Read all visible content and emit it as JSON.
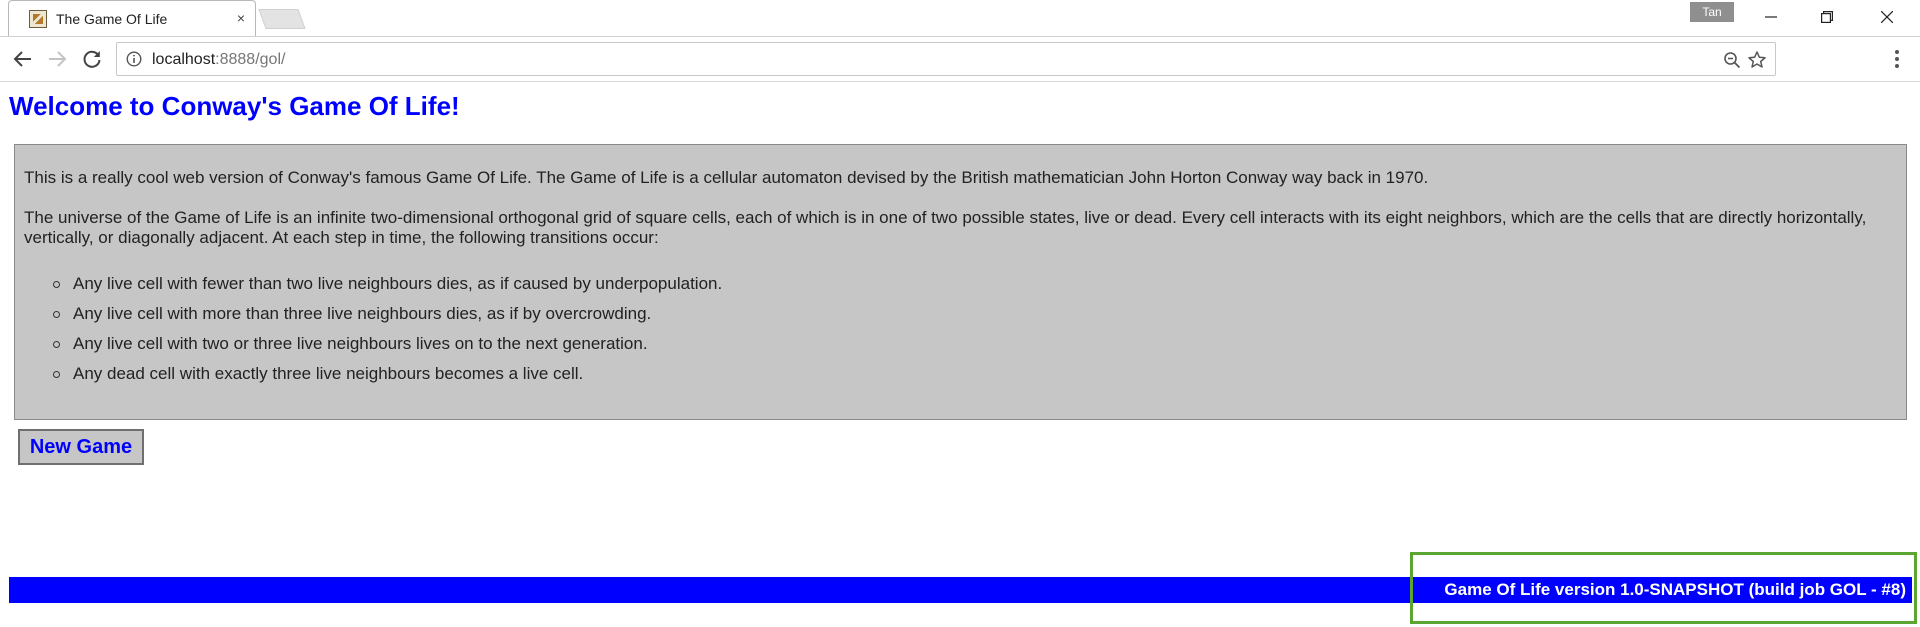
{
  "browser": {
    "tab_title": "The Game Of Life",
    "tab_close": "×",
    "profile_name": "Tan",
    "url_host": "localhost",
    "url_path": ":8888/gol/"
  },
  "page": {
    "title": "Welcome to Conway's Game Of Life!",
    "intro_paragraph_1": "This is a really cool web version of Conway's famous Game Of Life. The Game of Life is a cellular automaton devised by the British mathematician John Horton Conway way back in 1970.",
    "intro_paragraph_2": "The universe of the Game of Life is an infinite two-dimensional orthogonal grid of square cells, each of which is in one of two possible states, live or dead. Every cell interacts with its eight neighbors, which are the cells that are directly horizontally, vertically, or diagonally adjacent. At each step in time, the following transitions occur:",
    "rules": [
      "Any live cell with fewer than two live neighbours dies, as if caused by underpopulation.",
      "Any live cell with more than three live neighbours dies, as if by overcrowding.",
      "Any live cell with two or three live neighbours lives on to the next generation.",
      "Any dead cell with exactly three live neighbours becomes a live cell."
    ],
    "new_game_label": "New Game",
    "footer_text": "Game Of Life version 1.0-SNAPSHOT (build job GOL - #8)"
  },
  "colors": {
    "title": "#0000ff",
    "intro_background": "#c6c6c6",
    "footer_background": "#0000ff",
    "footer_text": "#ffffff",
    "highlight_border": "#5aa630"
  },
  "icons": {
    "back": "arrow-left-icon",
    "forward": "arrow-right-icon",
    "reload": "reload-icon",
    "site_info": "info-icon",
    "zoom": "zoom-out-icon",
    "bookmark": "star-icon",
    "menu": "kebab-menu-icon",
    "favicon": "game-of-life-favicon"
  }
}
